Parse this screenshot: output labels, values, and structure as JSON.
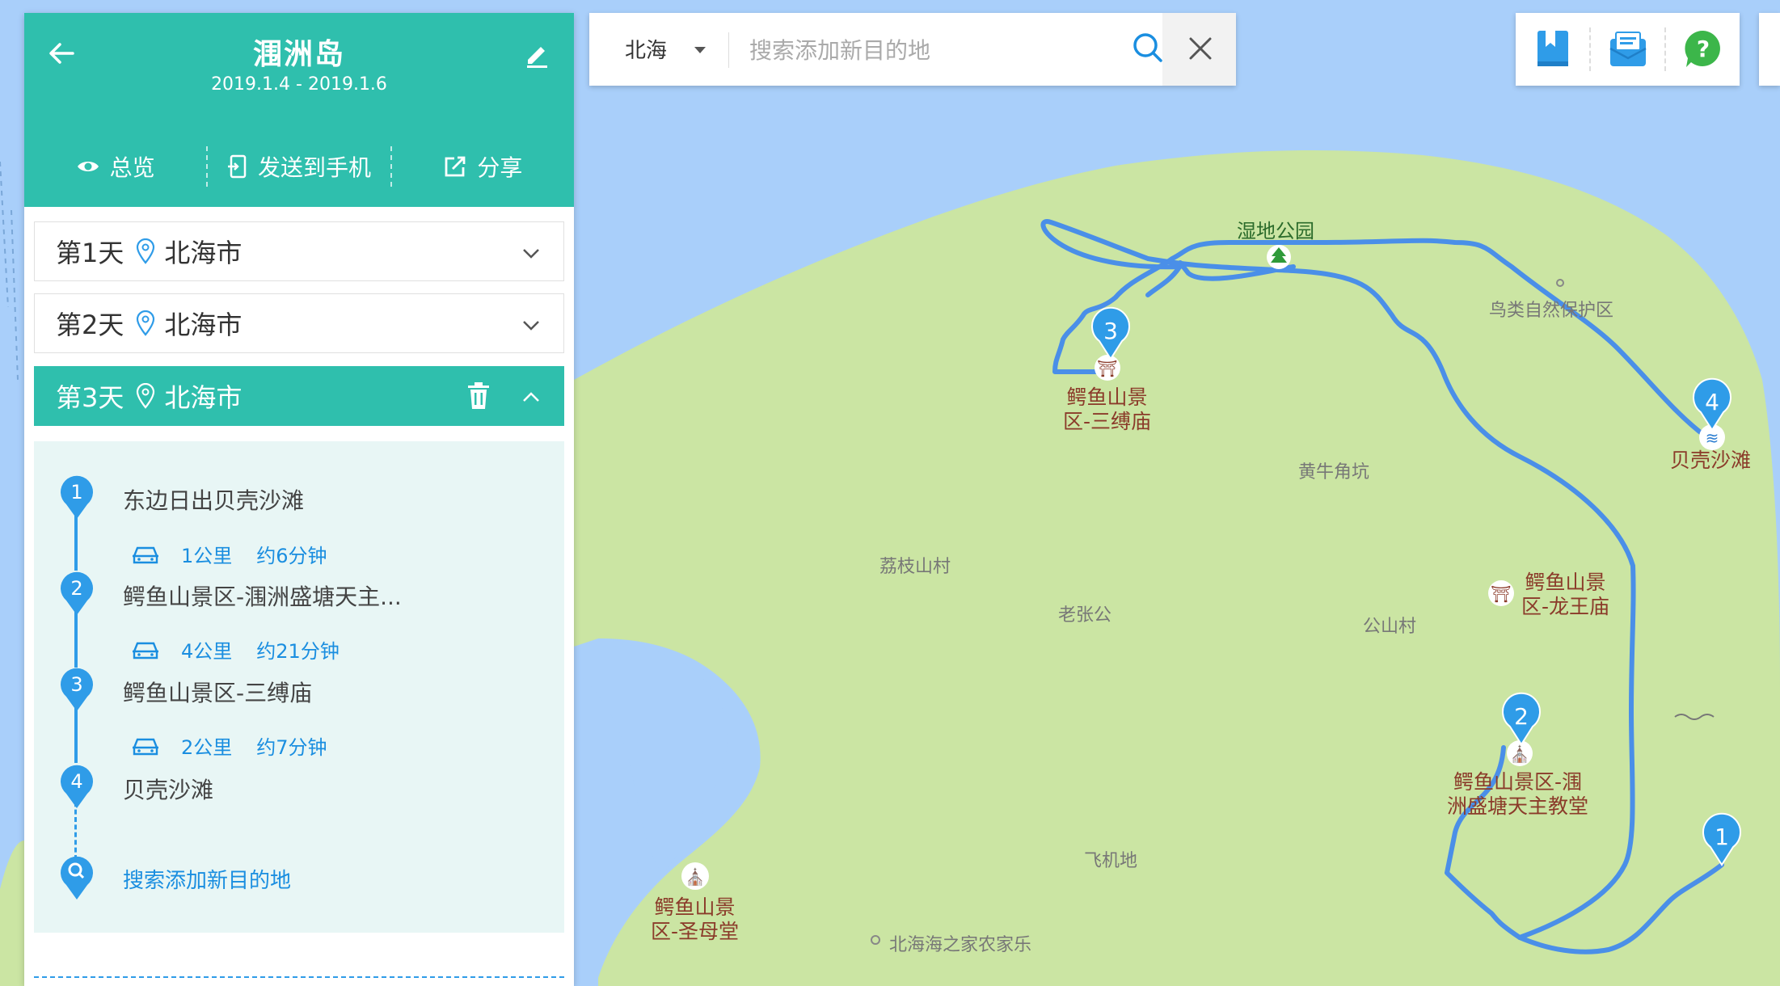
{
  "trip": {
    "title": "涠洲岛",
    "dates": "2019.1.4 - 2019.1.6",
    "actions": {
      "overview": "总览",
      "send_to_phone": "发送到手机",
      "share": "分享"
    }
  },
  "days": [
    {
      "label": "第1天",
      "city": "北海市",
      "expanded": false
    },
    {
      "label": "第2天",
      "city": "北海市",
      "expanded": false
    },
    {
      "label": "第3天",
      "city": "北海市",
      "expanded": true
    }
  ],
  "day3_stops": [
    {
      "num": "1",
      "name": "东边日出贝壳沙滩"
    },
    {
      "num": "2",
      "name": "鳄鱼山景区-涠洲盛塘天主..."
    },
    {
      "num": "3",
      "name": "鳄鱼山景区-三缚庙"
    },
    {
      "num": "4",
      "name": "贝壳沙滩"
    }
  ],
  "day3_segments": [
    {
      "distance": "1公里",
      "duration": "约6分钟"
    },
    {
      "distance": "4公里",
      "duration": "约21分钟"
    },
    {
      "distance": "2公里",
      "duration": "约7分钟"
    }
  ],
  "add_destination": "搜索添加新目的地",
  "search": {
    "city": "北海",
    "placeholder": "搜索添加新目的地",
    "value": ""
  },
  "toolbar": {
    "icons": [
      "bookmark-icon",
      "message-icon",
      "help-icon"
    ]
  },
  "map": {
    "colors": {
      "water": "#a9cffa",
      "land": "#cbe5a3",
      "route": "#4a8fe8",
      "marker": "#2f9ce8",
      "accent": "#2fbfad",
      "poi_text": "#8b3b2a"
    },
    "labels": {
      "wetland_park": "湿地公园",
      "bird_reserve": "鸟类自然保护区",
      "huangniujiaokeng": "黄牛角坑",
      "lizhishan": "荔枝山村",
      "laozhanggong": "老张公",
      "gongshan": "公山村",
      "airport": "飞机地",
      "farmstay": "北海海之家农家乐",
      "poi_sanfu": "鳄鱼山景区-三缚庙",
      "poi_sanfu_l1": "鳄鱼山景",
      "poi_sanfu_l2": "区-三缚庙",
      "poi_longwang_l1": "鳄鱼山景",
      "poi_longwang_l2": "区-龙王庙",
      "poi_church_l1": "鳄鱼山景区-涠",
      "poi_church_l2": "洲盛塘天主教堂",
      "poi_shengmu_l1": "鳄鱼山景",
      "poi_shengmu_l2": "区-圣母堂",
      "beach": "贝壳沙滩"
    },
    "markers": [
      {
        "num": "1",
        "stop": "东边日出贝壳沙滩"
      },
      {
        "num": "2",
        "stop": "鳄鱼山景区-涠洲盛塘天主教堂"
      },
      {
        "num": "3",
        "stop": "鳄鱼山景区-三缚庙"
      },
      {
        "num": "4",
        "stop": "贝壳沙滩"
      }
    ]
  }
}
